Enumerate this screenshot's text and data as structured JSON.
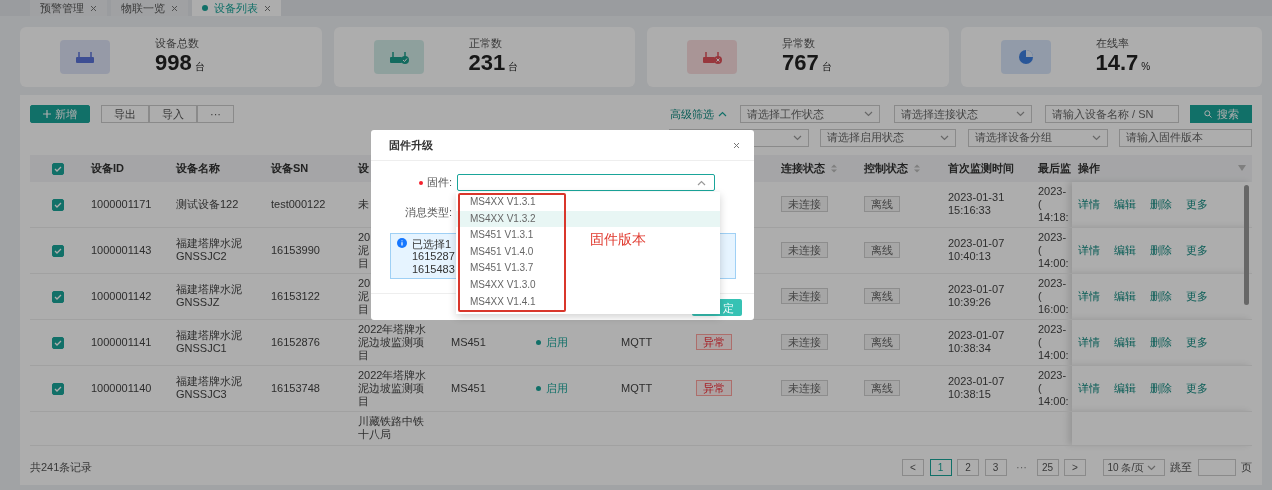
{
  "tabs": [
    {
      "label": "预警管理",
      "selected": false
    },
    {
      "label": "物联一览",
      "selected": false
    },
    {
      "label": "设备列表",
      "selected": true
    }
  ],
  "stats": [
    {
      "kind": "router",
      "label": "设备总数",
      "value": "998",
      "unit": "台"
    },
    {
      "kind": "router-ok",
      "label": "正常数",
      "value": "231",
      "unit": "台"
    },
    {
      "kind": "router-error",
      "label": "异常数",
      "value": "767",
      "unit": "台"
    },
    {
      "kind": "pie",
      "label": "在线率",
      "value": "14.7",
      "unit": "%"
    }
  ],
  "toolbar": {
    "add_button": "新增",
    "group_buttons": [
      "导出",
      "导入",
      "···"
    ]
  },
  "filters": {
    "toggle": "高级筛选",
    "expanded": true,
    "row1": [
      {
        "kind": "select",
        "placeholder": "请选择工作状态"
      },
      {
        "kind": "select",
        "placeholder": "请选择连接状态"
      },
      {
        "kind": "input",
        "placeholder": "请输入设备名称 / SN"
      }
    ],
    "search_button": "搜索",
    "row2": [
      {
        "kind": "select"
      },
      {
        "kind": "select",
        "placeholder": "请选择启用状态"
      },
      {
        "kind": "select",
        "placeholder": "请选择设备分组"
      },
      {
        "kind": "input",
        "placeholder": "请输入固件版本"
      }
    ]
  },
  "table": {
    "all_checked": true,
    "columns": [
      {
        "label": "设备ID"
      },
      {
        "label": "设备名称"
      },
      {
        "label": "设备SN"
      },
      {
        "label": "设"
      },
      {},
      {},
      {},
      {},
      {
        "label": "连接状态",
        "sortable": true
      },
      {
        "label": "控制状态",
        "sortable": true
      },
      {
        "label": "首次监测时间"
      },
      {
        "label": "最后监"
      },
      {
        "label": "操作",
        "filter": true
      }
    ],
    "rows": [
      {
        "checked": true,
        "cells": [
          "1000001171",
          "测试设备122",
          "test000122",
          "未",
          null,
          null,
          null,
          null,
          {
            "kind": "muted-tag",
            "text": "未连接"
          },
          {
            "kind": "muted-tag",
            "text": "离线"
          },
          "2023-01-31\n15:16:33",
          "2023-(\n14:18:",
          {
            "kind": "actions",
            "links": [
              "详情",
              "编辑",
              "删除",
              "更多"
            ]
          }
        ]
      },
      {
        "checked": true,
        "cells": [
          "1000001143",
          "福建塔牌水泥\nGNSSJC2",
          "16153990",
          {
            "kind": "lines",
            "lines": [
              "20",
              "泥",
              "目"
            ]
          },
          null,
          null,
          null,
          null,
          {
            "kind": "muted-tag",
            "text": "未连接"
          },
          {
            "kind": "muted-tag",
            "text": "离线"
          },
          "2023-01-07\n10:40:13",
          "2023-(\n14:00:",
          {
            "kind": "actions",
            "links": [
              "详情",
              "编辑",
              "删除",
              "更多"
            ]
          }
        ]
      },
      {
        "checked": true,
        "cells": [
          "1000001142",
          "福建塔牌水泥\nGNSSJZ",
          "16153122",
          {
            "kind": "lines",
            "lines": [
              "20",
              "泥",
              "目"
            ]
          },
          null,
          null,
          null,
          null,
          {
            "kind": "muted-tag",
            "text": "未连接"
          },
          {
            "kind": "muted-tag",
            "text": "离线"
          },
          "2023-01-07\n10:39:26",
          "2023-(\n16:00:",
          {
            "kind": "actions",
            "links": [
              "详情",
              "编辑",
              "删除",
              "更多"
            ]
          }
        ]
      },
      {
        "checked": true,
        "cells": [
          "1000001141",
          "福建塔牌水泥\nGNSSJC1",
          "16152876",
          "2022年塔牌水泥边坡监测项目",
          "MS451",
          {
            "kind": "dot",
            "text": "启用"
          },
          "MQTT",
          {
            "kind": "danger-tag",
            "text": "异常"
          },
          {
            "kind": "muted-tag",
            "text": "未连接"
          },
          {
            "kind": "muted-tag",
            "text": "离线"
          },
          "2023-01-07\n10:38:34",
          "2023-(\n14:00:",
          {
            "kind": "actions",
            "links": [
              "详情",
              "编辑",
              "删除",
              "更多"
            ]
          }
        ]
      },
      {
        "checked": true,
        "cells": [
          "1000001140",
          "福建塔牌水泥\nGNSSJC3",
          "16153748",
          "2022年塔牌水泥边坡监测项目",
          "MS451",
          {
            "kind": "dot",
            "text": "启用"
          },
          "MQTT",
          {
            "kind": "danger-tag",
            "text": "异常"
          },
          {
            "kind": "muted-tag",
            "text": "未连接"
          },
          {
            "kind": "muted-tag",
            "text": "离线"
          },
          "2023-01-07\n10:38:15",
          "2023-(\n14:00:",
          {
            "kind": "actions",
            "links": [
              "详情",
              "编辑",
              "删除",
              "更多"
            ]
          }
        ]
      },
      {
        "cells": [
          null,
          null,
          null,
          "川藏铁路中铁十八局",
          null,
          null,
          null,
          null,
          null,
          null,
          null,
          null,
          null
        ]
      }
    ]
  },
  "footer": {
    "total": "共241条记录",
    "prev": "<",
    "next": ">",
    "pages": [
      {
        "label": "1",
        "selected": true
      },
      {
        "label": "2",
        "selected": false
      },
      {
        "label": "3",
        "selected": false
      },
      {
        "kind": "ellipsis",
        "label": "···"
      },
      {
        "label": "25",
        "selected": false
      }
    ],
    "page_size": "10 条/页",
    "jump_label": "跳至",
    "jump_suffix": "页"
  },
  "dialog": {
    "title": "固件升级",
    "fields": [
      {
        "label": "固件:",
        "required": true,
        "kind": "select",
        "expanded": true
      },
      {
        "label": "消息类型:",
        "required": false,
        "kind": "hidden-value"
      }
    ],
    "alert": {
      "lines": [
        "已选择1",
        "1615287",
        "1615483"
      ]
    },
    "ok_button": "定",
    "dropdown": [
      {
        "label": "MS4XX V1.3.1",
        "selected": false
      },
      {
        "label": "MS4XX V1.3.2",
        "selected": true
      },
      {
        "label": "MS451 V1.3.1",
        "selected": false
      },
      {
        "label": "MS451 V1.4.0",
        "selected": false
      },
      {
        "label": "MS451 V1.3.7",
        "selected": false
      },
      {
        "label": "MS4XX V1.3.0",
        "selected": false
      },
      {
        "label": "MS4XX V1.4.1",
        "selected": false
      }
    ],
    "annotation": {
      "label": "固件版本"
    }
  }
}
